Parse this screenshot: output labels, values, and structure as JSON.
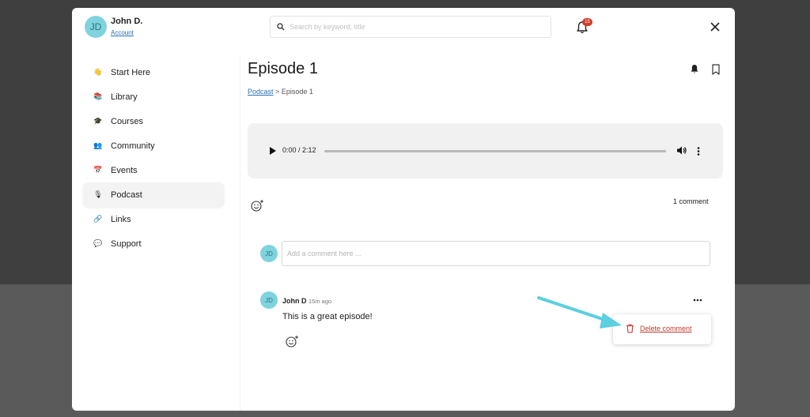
{
  "user": {
    "initials": "JD",
    "name": "John D.",
    "account_link": "Account"
  },
  "search": {
    "placeholder": "Search by keyword, title"
  },
  "notifications": {
    "count": "15"
  },
  "sidebar": {
    "items": [
      {
        "label": "Start Here",
        "icon": "waving-hand-icon"
      },
      {
        "label": "Library",
        "icon": "books-icon"
      },
      {
        "label": "Courses",
        "icon": "graduation-cap-icon"
      },
      {
        "label": "Community",
        "icon": "people-icon"
      },
      {
        "label": "Events",
        "icon": "calendar-icon"
      },
      {
        "label": "Podcast",
        "icon": "microphone-icon",
        "active": true
      },
      {
        "label": "Links",
        "icon": "link-icon"
      },
      {
        "label": "Support",
        "icon": "speech-bubble-icon"
      }
    ]
  },
  "main": {
    "title": "Episode 1",
    "breadcrumb": {
      "parent": "Podcast",
      "separator": ">",
      "current": "Episode 1"
    }
  },
  "player": {
    "time": "0:00 / 2:12",
    "progress": 0
  },
  "comments": {
    "count_label": "1 comment",
    "input_placeholder": "Add a comment here ...",
    "current_user_initials": "JD",
    "items": [
      {
        "initials": "JD",
        "author": "John D",
        "time": "15m ago",
        "text": "This is a great episode!"
      }
    ]
  },
  "context_menu": {
    "delete_label": "Delete comment"
  },
  "colors": {
    "avatar": "#7fd3df",
    "link": "#2a6fb5",
    "danger": "#c0392b",
    "badge": "#d23a2a",
    "annotation_arrow": "#5ccfe0"
  }
}
